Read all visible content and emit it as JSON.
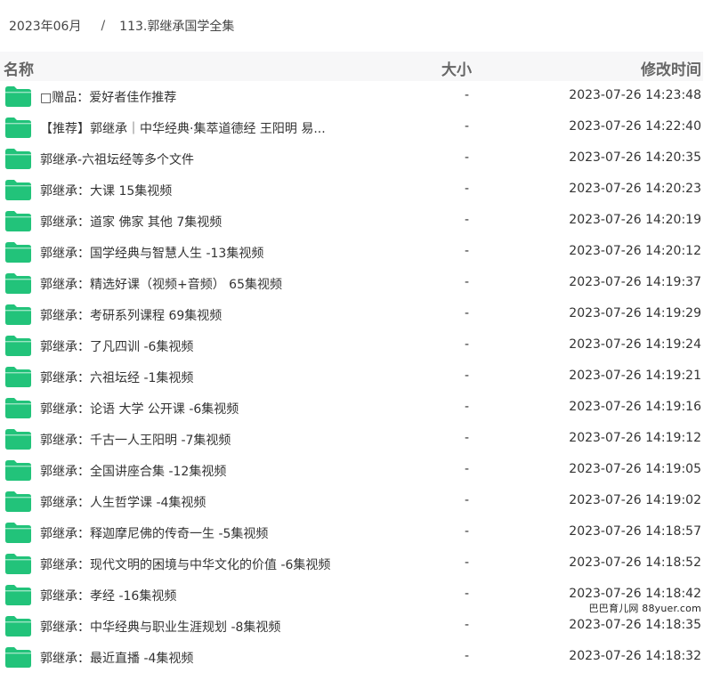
{
  "breadcrumb": {
    "parent": "2023年06月",
    "separator": "/",
    "current": "113.郭继承国学全集"
  },
  "columns": {
    "name": "名称",
    "size": "大小",
    "time": "修改时间"
  },
  "folder_color": "#22c37a",
  "rows": [
    {
      "name": "□赠品：爱好者佳作推荐",
      "size": "-",
      "time": "2023-07-26 14:23:48"
    },
    {
      "name": "【推荐】郭继承｜中华经典·集萃道德经 王阳明 易...",
      "size": "-",
      "time": "2023-07-26 14:22:40"
    },
    {
      "name": "郭继承-六祖坛经等多个文件",
      "size": "-",
      "time": "2023-07-26 14:20:35"
    },
    {
      "name": "郭继承：大课 15集视频",
      "size": "-",
      "time": "2023-07-26 14:20:23"
    },
    {
      "name": "郭继承：道家 佛家 其他 7集视频",
      "size": "-",
      "time": "2023-07-26 14:20:19"
    },
    {
      "name": "郭继承：国学经典与智慧人生 -13集视频",
      "size": "-",
      "time": "2023-07-26 14:20:12"
    },
    {
      "name": "郭继承：精选好课（视频+音频） 65集视频",
      "size": "-",
      "time": "2023-07-26 14:19:37"
    },
    {
      "name": "郭继承：考研系列课程 69集视频",
      "size": "-",
      "time": "2023-07-26 14:19:29"
    },
    {
      "name": "郭继承：了凡四训 -6集视频",
      "size": "-",
      "time": "2023-07-26 14:19:24"
    },
    {
      "name": "郭继承：六祖坛经 -1集视频",
      "size": "-",
      "time": "2023-07-26 14:19:21"
    },
    {
      "name": "郭继承：论语 大学 公开课 -6集视频",
      "size": "-",
      "time": "2023-07-26 14:19:16"
    },
    {
      "name": "郭继承：千古一人王阳明 -7集视频",
      "size": "-",
      "time": "2023-07-26 14:19:12"
    },
    {
      "name": "郭继承：全国讲座合集 -12集视频",
      "size": "-",
      "time": "2023-07-26 14:19:05"
    },
    {
      "name": "郭继承：人生哲学课 -4集视频",
      "size": "-",
      "time": "2023-07-26 14:19:02"
    },
    {
      "name": "郭继承：释迦摩尼佛的传奇一生 -5集视频",
      "size": "-",
      "time": "2023-07-26 14:18:57"
    },
    {
      "name": "郭继承：现代文明的困境与中华文化的价值 -6集视频",
      "size": "-",
      "time": "2023-07-26 14:18:52"
    },
    {
      "name": "郭继承：孝经 -16集视频",
      "size": "-",
      "time": "2023-07-26 14:18:42"
    },
    {
      "name": "郭继承：中华经典与职业生涯规划 -8集视频",
      "size": "-",
      "time": "2023-07-26 14:18:35"
    },
    {
      "name": "郭继承：最近直播 -4集视频",
      "size": "-",
      "time": "2023-07-26 14:18:32"
    }
  ],
  "watermark": "巴巴育儿网 88yuer.com"
}
